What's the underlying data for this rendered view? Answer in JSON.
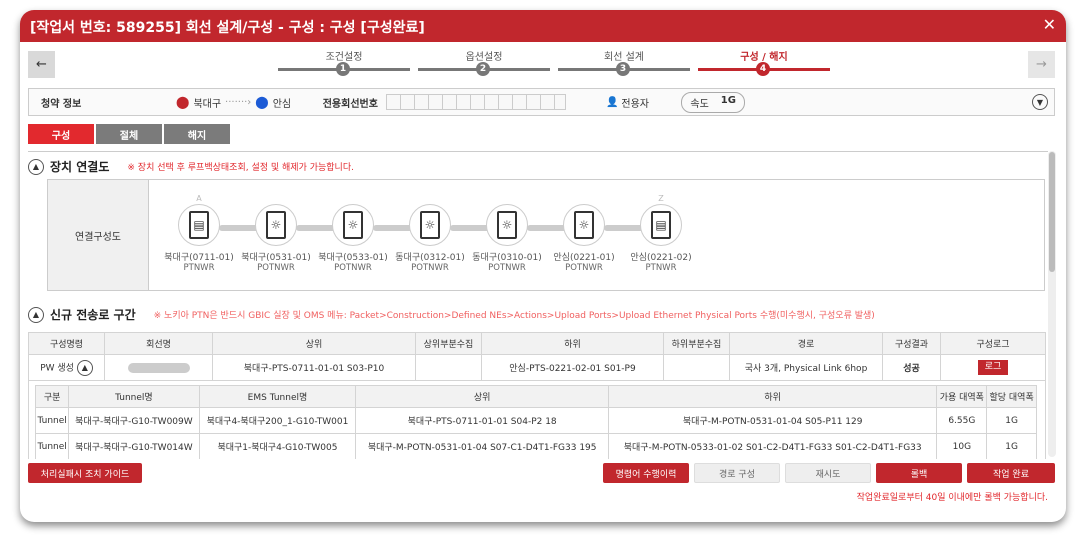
{
  "window": {
    "title": "[작업서 번호: 589255] 회선 설계/구성 - 구성 : 구성 [구성완료]"
  },
  "steps": [
    {
      "label": "조건설정",
      "num": "1"
    },
    {
      "label": "옵션설정",
      "num": "2"
    },
    {
      "label": "회선 설계",
      "num": "3"
    },
    {
      "label": "구성 / 해지",
      "num": "4"
    }
  ],
  "info": {
    "title": "청약 정보",
    "from": "북대구",
    "to": "안심",
    "line_label": "전용회선번호",
    "user_label": "전용자",
    "speed_label": "속도",
    "speed": "1G"
  },
  "tabs": [
    "구성",
    "절체",
    "해지"
  ],
  "section1": {
    "title": "장치 연결도",
    "note": "※ 장치 선택 후 루프백상태조회, 설정 및 해제가 가능합니다.",
    "row_label": "연결구성도",
    "nodes": [
      {
        "name": "북대구(0711-01)",
        "type": "PTNWR",
        "mark": "A"
      },
      {
        "name": "북대구(0531-01)",
        "type": "POTNWR",
        "mark": ""
      },
      {
        "name": "북대구(0533-01)",
        "type": "POTNWR",
        "mark": ""
      },
      {
        "name": "동대구(0312-01)",
        "type": "POTNWR",
        "mark": ""
      },
      {
        "name": "동대구(0310-01)",
        "type": "POTNWR",
        "mark": ""
      },
      {
        "name": "안심(0221-01)",
        "type": "POTNWR",
        "mark": ""
      },
      {
        "name": "안심(0221-02)",
        "type": "PTNWR",
        "mark": "Z"
      }
    ]
  },
  "section2": {
    "title": "신규 전송로 구간",
    "note": "※ 노키아 PTN은 반드시 GBIC 실장 및 OMS 메뉴: Packet>Construction>Defined NEs>Actions>Upload Ports>Upload Ethernet Physical Ports 수행(미수행시, 구성오류 발생)",
    "headers": [
      "구성명령",
      "회선명",
      "상위",
      "상위부분수집",
      "하위",
      "하위부분수집",
      "경로",
      "구성결과",
      "구성로그"
    ],
    "row": {
      "cmd": "PW 생성",
      "upper": "북대구-PTS-0711-01-01 S03-P10",
      "lower": "안심-PTS-0221-02-01 S01-P9",
      "route": "국사 3개, Physical Link 6hop",
      "result": "성공",
      "log": "로그"
    },
    "sub_headers": [
      "구분",
      "Tunnel명",
      "EMS Tunnel명",
      "상위",
      "하위",
      "가용 대역폭",
      "할당 대역폭"
    ],
    "sub_rows": [
      [
        "Tunnel",
        "북대구-북대구-G10-TW009W",
        "북대구4-북대구200_1-G10-TW001",
        "북대구-PTS-0711-01-01 S04-P2 18",
        "북대구-M-POTN-0531-01-04 S05-P11 129",
        "6.55G",
        "1G"
      ],
      [
        "Tunnel",
        "북대구-북대구-G10-TW014W",
        "북대구1-북대구4-G10-TW005",
        "북대구-M-POTN-0531-01-04 S07-C1-D4T1-FG33 195",
        "북대구-M-POTN-0533-01-02 S01-C2-D4T1-FG33 S01-C2-D4T1-FG33",
        "10G",
        "1G"
      ]
    ]
  },
  "buttons": {
    "guide": "처리실패시 조치 가이드",
    "history": "명령어 수행이력",
    "route": "경로 구성",
    "retry": "재시도",
    "rollback": "롤백",
    "complete": "작업 완료"
  },
  "footer_note": "작업완료일로부터 40일 이내에만 롤백 가능합니다."
}
